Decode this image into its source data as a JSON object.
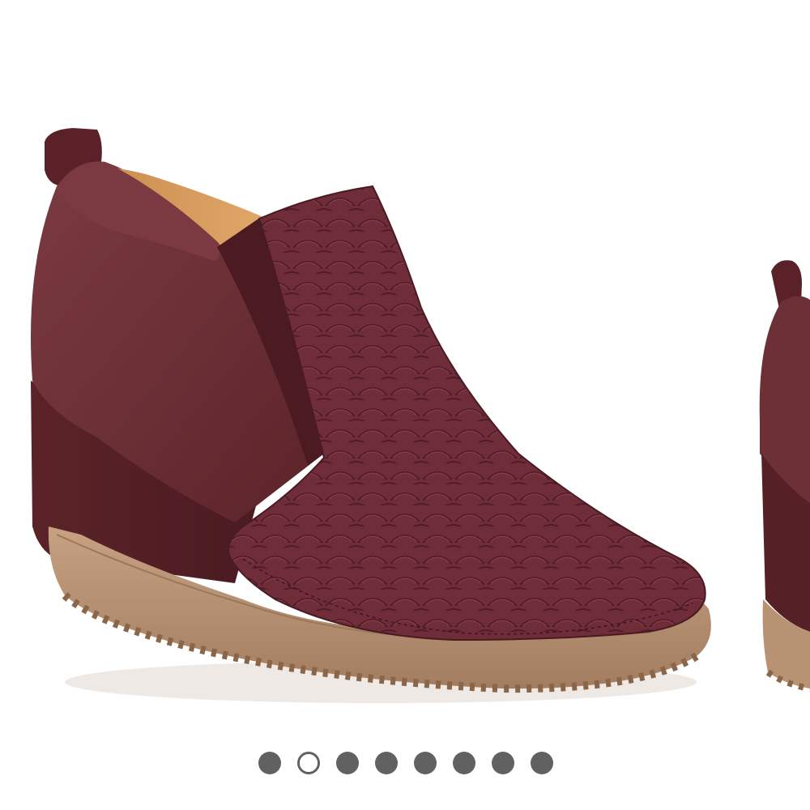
{
  "gallery": {
    "slide_count": 8,
    "active_index": 1,
    "colors": {
      "dot_fill": "#616161",
      "active_dot_border": "#616161",
      "background": "#ffffff",
      "suede": "#6b2f35",
      "sole": "#b89373"
    },
    "slides": [
      {
        "image": "shoe-side-view",
        "state": "current"
      },
      {
        "image": "shoe-partial-next",
        "state": "peek"
      }
    ]
  }
}
